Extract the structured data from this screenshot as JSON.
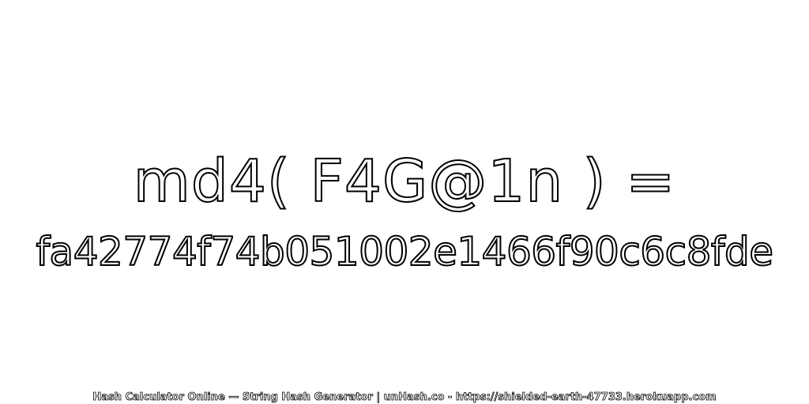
{
  "heading": {
    "expression": "md4( F4G@1n ) =",
    "hash_value": "fa42774f74b051002e1466f90c6c8fde"
  },
  "footer": {
    "text": "Hash Calculator Online — String Hash Generator | unHash.co - https://shielded-earth-47733.herokuapp.com"
  },
  "colors": {
    "background": "#ffffff",
    "text_fill": "#ffffff",
    "text_outline": "#000000"
  }
}
